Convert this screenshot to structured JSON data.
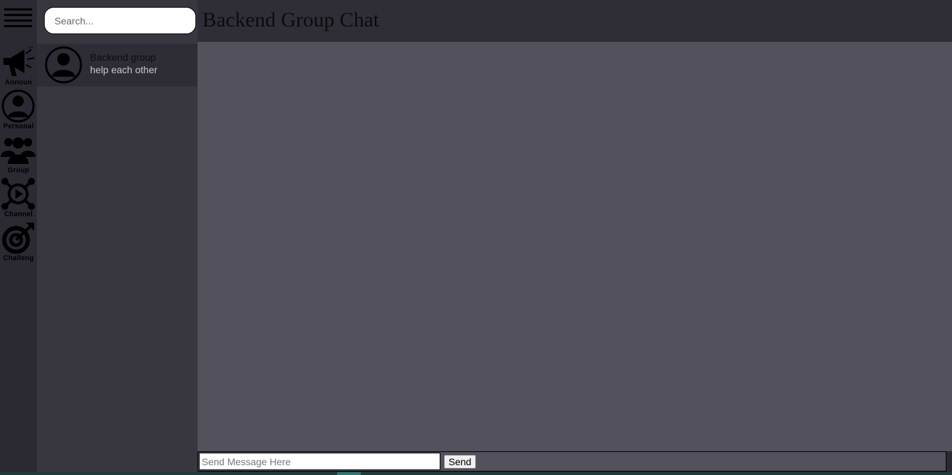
{
  "sidebar": {
    "menu_icon": "hamburger-menu-icon",
    "items": [
      {
        "label": "Announ",
        "icon": "megaphone-icon"
      },
      {
        "label": "Personal",
        "icon": "user-circle-icon"
      },
      {
        "label": "Group",
        "icon": "users-group-icon"
      },
      {
        "label": "Channel",
        "icon": "channel-network-icon"
      },
      {
        "label": "Challeng",
        "icon": "target-icon"
      }
    ]
  },
  "search": {
    "placeholder": "Search...",
    "value": ""
  },
  "conversations": [
    {
      "name": "Backend group",
      "subtitle": "help each other",
      "avatar_icon": "user-circle-icon"
    }
  ],
  "chat": {
    "title": "Backend Group Chat",
    "messages": [],
    "composer": {
      "placeholder": "Send Message Here",
      "value": "",
      "send_label": "Send"
    }
  },
  "colors": {
    "rail_bg": "#2b2a33",
    "list_bg": "#38373f",
    "active_item_bg": "#2e2d35",
    "header_bg": "#2f2e37",
    "messages_bg": "#53515c",
    "subtitle_text": "#c9c6d2"
  }
}
